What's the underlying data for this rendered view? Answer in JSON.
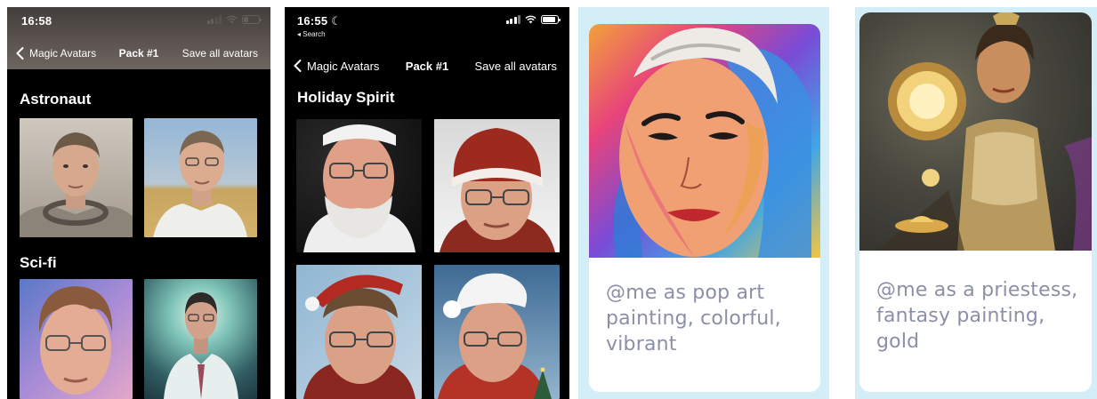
{
  "screens": [
    {
      "status_time": "16:58",
      "nav": {
        "back_label": "Magic Avatars",
        "title": "Pack #1",
        "action_label": "Save all avatars"
      },
      "sections": [
        {
          "title": "Astronaut"
        },
        {
          "title": "Sci-fi"
        }
      ]
    },
    {
      "status_time": "16:55",
      "back_app_label": "◂ Search",
      "nav": {
        "back_label": "Magic Avatars",
        "title": "Pack #1",
        "action_label": "Save all avatars"
      },
      "sections": [
        {
          "title": "Holiday Spirit"
        }
      ]
    }
  ],
  "cards": [
    {
      "prompt_lines": [
        "@me as pop art",
        "painting, colorful,",
        "vibrant"
      ]
    },
    {
      "prompt_lines": [
        "@me as a priestess,",
        "fantasy painting,",
        "gold"
      ]
    }
  ],
  "icons": {
    "back": "chevron-left-icon",
    "signal": "cellular-signal-icon",
    "wifi": "wifi-icon",
    "battery": "battery-icon",
    "moon": "moon-icon"
  },
  "colors": {
    "phone_background": "#000000",
    "card_frame": "#d4eef8",
    "prompt_text": "#8b8fa8"
  }
}
